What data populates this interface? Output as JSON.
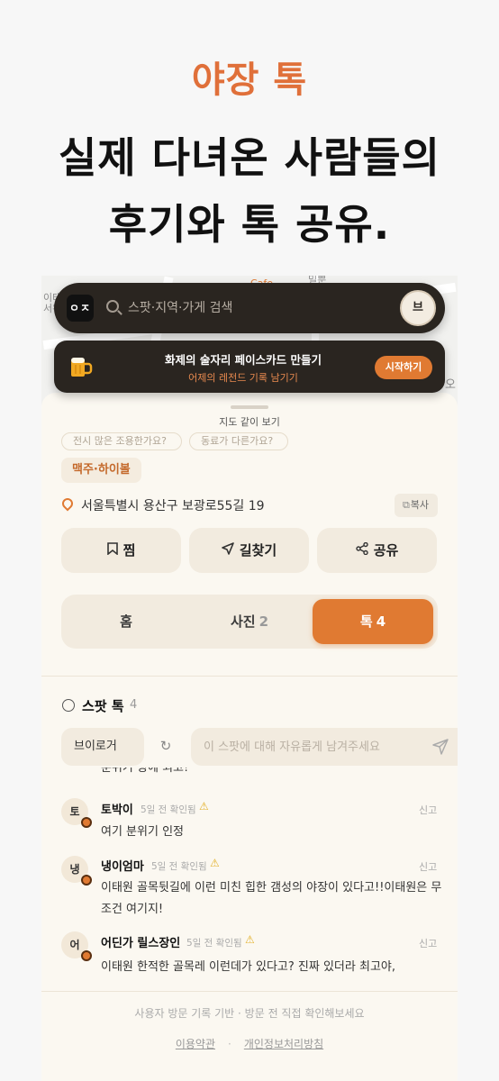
{
  "hero": {
    "brand": "야장 톡",
    "headline_line1": "실제 다녀온 사람들의",
    "headline_line2": "후기와 톡 공유."
  },
  "map": {
    "labels": [
      "이태",
      "서위",
      "Cafe",
      "밀뿐",
      "오"
    ]
  },
  "search": {
    "logo": "ㅇㅈ",
    "placeholder": "스팟·지역·가게 검색",
    "avatar": "브"
  },
  "promo": {
    "title": "화제의 술자리 페이스카드 만들기",
    "subtitle": "어제의 레전드 기록 남기기",
    "button": "시작하기"
  },
  "sheet": {
    "map_view_link": "지도 같이 보기",
    "faded_chips": [
      "전시 많은 조용한가요?",
      "동료가 다른가요?"
    ],
    "tag": "맥주·하이볼",
    "address": "서울특별시 용산구 보광로55길 19",
    "copy_label": "복사"
  },
  "actions": {
    "save": "찜",
    "directions": "길찾기",
    "share": "공유"
  },
  "tabs": [
    {
      "label": "홈",
      "count": ""
    },
    {
      "label": "사진",
      "count": "2"
    },
    {
      "label": "톡",
      "count": "4"
    }
  ],
  "talk": {
    "header": "스팟 톡",
    "count": "4",
    "nickname": "브이로거",
    "input_placeholder": "이 스팟에 대해 자유롭게 남겨주세요",
    "clipped_text": "분위기 짱에 최고!"
  },
  "comments": [
    {
      "avatar": "토",
      "name": "토박이",
      "meta": "5일 전 확인됨",
      "report": "신고",
      "body": "여기 분위기 인정"
    },
    {
      "avatar": "냉",
      "name": "냉이엄마",
      "meta": "5일 전 확인됨",
      "report": "신고",
      "body": "이태원 골목뒷길에 이런 미친 힙한 갬성의 야장이 있다고!!이태원은 무조건 여기지!"
    },
    {
      "avatar": "어",
      "name": "어딘가 릴스장인",
      "meta": "5일 전 확인됨",
      "report": "신고",
      "body": "이태원 한적한 골목레 이런데가 있다고? 진짜 있더라 최고야,"
    }
  ],
  "footer": {
    "note": "사용자 방문 기록 기반 · 방문 전 직접 확인해보세요",
    "terms": "이용약관",
    "separator": "·",
    "privacy": "개인정보처리방침"
  },
  "colors": {
    "accent": "#e07a32",
    "brand_title": "#e0703a",
    "dark_bar": "#2a2520",
    "sheet_bg": "#fbf8f1"
  }
}
